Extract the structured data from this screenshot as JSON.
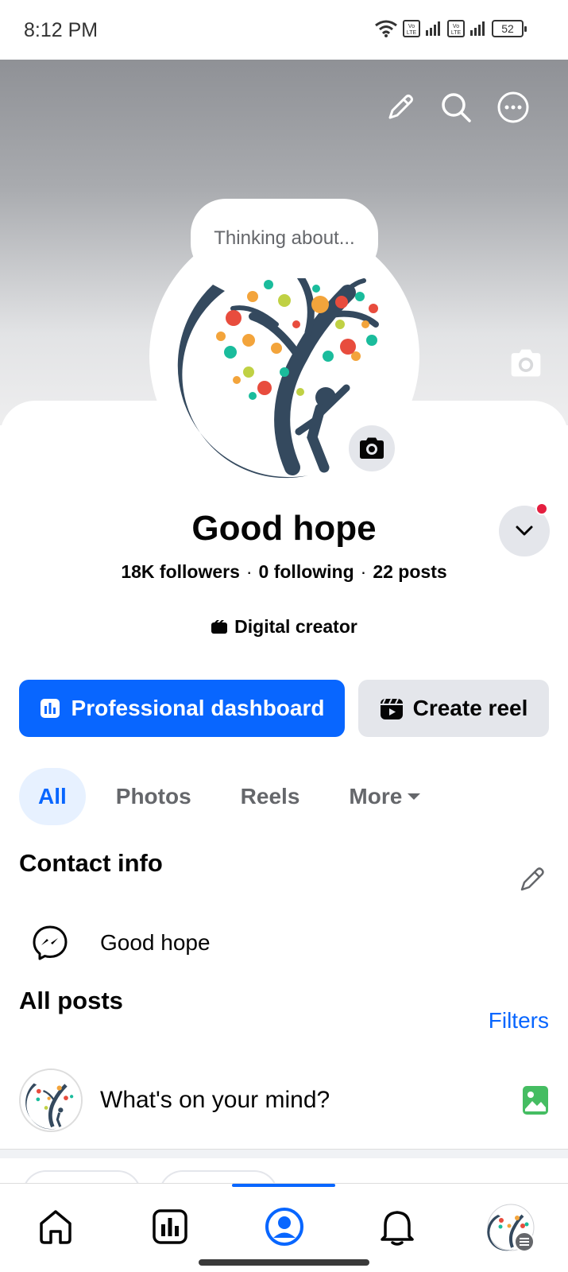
{
  "status_bar": {
    "time": "8:12 PM",
    "battery": "52",
    "icons": [
      "wifi-icon",
      "volte-icon",
      "signal-icon",
      "volte-icon",
      "signal-icon",
      "battery-icon"
    ]
  },
  "cover": {
    "actions": [
      "pencil-icon",
      "search-icon",
      "more-icon"
    ],
    "camera_icon": "camera-icon"
  },
  "thought_bubble": {
    "text": "Thinking about..."
  },
  "profile": {
    "name": "Good hope",
    "followers": "18K followers",
    "following": "0 following",
    "posts": "22 posts",
    "separator": "·",
    "category": "Digital creator",
    "notification_color": "#e41e3f"
  },
  "actions": {
    "primary_label": "Professional dashboard",
    "secondary_label": "Create reel",
    "primary_color": "#0866ff"
  },
  "tabs": [
    {
      "label": "All",
      "active": true
    },
    {
      "label": "Photos",
      "active": false
    },
    {
      "label": "Reels",
      "active": false
    },
    {
      "label": "More",
      "active": false
    }
  ],
  "contact_info": {
    "title": "Contact info",
    "items": [
      {
        "icon": "messenger-icon",
        "value": "Good hope"
      }
    ]
  },
  "all_posts": {
    "title": "All posts",
    "filters_label": "Filters",
    "composer_placeholder": "What's on your mind?"
  },
  "bottom_nav": [
    {
      "name": "home",
      "icon": "home-icon",
      "active": false
    },
    {
      "name": "dashboard",
      "icon": "dashboard-icon",
      "active": false
    },
    {
      "name": "profile",
      "icon": "profile-icon",
      "active": true
    },
    {
      "name": "notifications",
      "icon": "bell-icon",
      "active": false
    },
    {
      "name": "menu",
      "icon": "avatar-menu-icon",
      "active": false
    }
  ]
}
